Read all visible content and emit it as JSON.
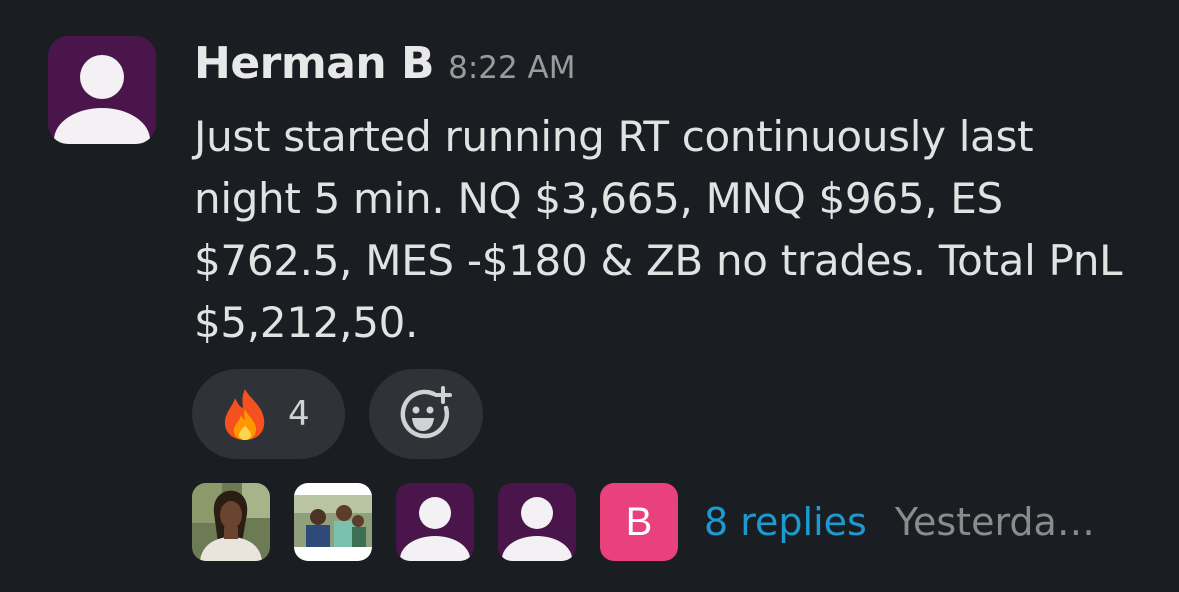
{
  "message": {
    "sender": "Herman B",
    "time": "8:22 AM",
    "text": "Just started running RT continuously last night 5 min. NQ $3,665, MNQ $965, ES $762.5, MES -$180 & ZB no trades. Total PnL $5,212,50."
  },
  "reactions": [
    {
      "emoji": "🔥",
      "icon": "fire-icon",
      "count": "4"
    }
  ],
  "add_reaction": {
    "icon": "add-emoji-icon"
  },
  "thread": {
    "participants": [
      {
        "type": "photo",
        "icon": "user-photo-1"
      },
      {
        "type": "photo",
        "icon": "user-photo-2"
      },
      {
        "type": "default",
        "icon": "default-user-icon"
      },
      {
        "type": "default",
        "icon": "default-user-icon"
      },
      {
        "type": "letter",
        "initial": "B"
      }
    ],
    "replies_label": "8 replies",
    "last_reply_label": "Yesterda…"
  },
  "colors": {
    "background": "#1a1d21",
    "avatar_purple": "#4a154b",
    "link_blue": "#1d9bd1",
    "letter_avatar": "#e8417c",
    "pill": "#2f3236"
  }
}
